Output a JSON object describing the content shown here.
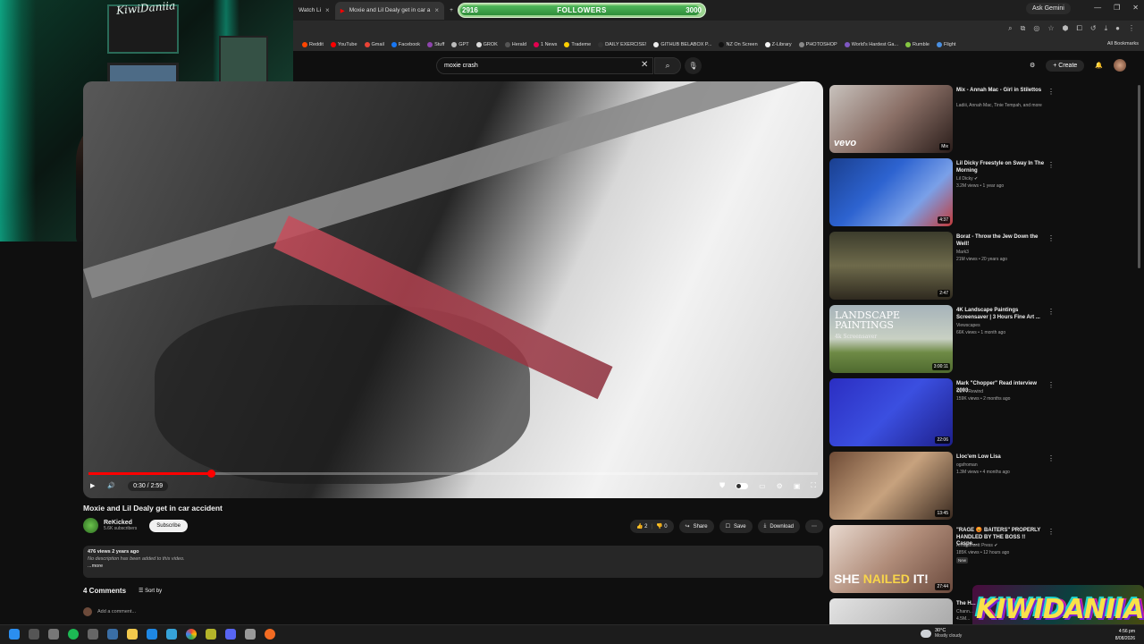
{
  "browser": {
    "tabs": [
      {
        "label": "Watch Li"
      },
      {
        "label": "Moxie and Lil Dealy get in car a"
      }
    ],
    "followers": {
      "current": "2916",
      "label": "FOLLOWERS",
      "goal": "3000",
      "progress_fraction": 0.972
    },
    "ask_gemini": "Ask Gemini",
    "bookmarks": [
      {
        "label": "Reddit",
        "color": "#ff4500"
      },
      {
        "label": "YouTube",
        "color": "#ff0000"
      },
      {
        "label": "Gmail",
        "color": "#ea4335"
      },
      {
        "label": "Facebook",
        "color": "#1877f2"
      },
      {
        "label": "Stuff",
        "color": "#8e44ad"
      },
      {
        "label": "GPT",
        "color": "#bbbbbb"
      },
      {
        "label": "GROK",
        "color": "#dddddd"
      },
      {
        "label": "Herald",
        "color": "#555555"
      },
      {
        "label": "1 News",
        "color": "#e3004f"
      },
      {
        "label": "Trademe",
        "color": "#ffcf00"
      },
      {
        "label": "DAILY EXERCISE!",
        "color": "#333333"
      },
      {
        "label": "GITHUB BELABOX P...",
        "color": "#eeeeee"
      },
      {
        "label": "NZ On Screen",
        "color": "#111111"
      },
      {
        "label": "Z-Library",
        "color": "#f5f5f5"
      },
      {
        "label": "PHOTOSHOP",
        "color": "#888888"
      },
      {
        "label": "World's Hardest Ga...",
        "color": "#7e57c2"
      },
      {
        "label": "Rumble",
        "color": "#85c742"
      },
      {
        "label": "Flight",
        "color": "#4a90e2"
      }
    ],
    "all_bookmarks": "All Bookmarks"
  },
  "youtube": {
    "search_value": "moxie crash",
    "create_label": "Create",
    "player": {
      "time": "0:30 / 2:59",
      "progress_fraction": 0.1676
    },
    "video_title": "Moxie and Lil Dealy get in car accident",
    "channel": {
      "name": "ReKicked",
      "subs": "5.6K subscribers",
      "subscribe": "Subscribe"
    },
    "actions": {
      "likes": "2",
      "dislikes": "0",
      "share": "Share",
      "save": "Save",
      "download": "Download"
    },
    "description": {
      "meta": "476 views  2 years ago",
      "text": "No description has been added to this video.",
      "more": "...more"
    },
    "comments": {
      "count": "4 Comments",
      "sort": "Sort by",
      "add": "Add a comment..."
    },
    "recommendations": [
      {
        "title": "Mix - Annah Mac - Girl in Stilettos",
        "channel": "Ladiii, Annah Mac, Tinie Tempah, and more",
        "meta": "",
        "duration": "Mix",
        "thumb": "vevo"
      },
      {
        "title": "Lil Dicky Freestyle on Sway In The Morning",
        "channel": "Lil Dicky ✔",
        "meta": "3.2M views • 1 year ago",
        "duration": "4:37",
        "thumb": "sway"
      },
      {
        "title": "Borat - Throw the Jew Down the Well!",
        "channel": "Mark3",
        "meta": "21M views • 20 years ago",
        "duration": "2:47",
        "thumb": "borat"
      },
      {
        "title": "4K Landscape Paintings Screensaver | 3 Hours Fine Art ...",
        "channel": "Viewscapes",
        "meta": "66K views • 1 month ago",
        "duration": "3:00:11",
        "thumb": "landscape"
      },
      {
        "title": "Mark \"Chopper\" Read interview 2003",
        "channel": "OZTVRewind",
        "meta": "159K views • 2 months ago",
        "duration": "22:06",
        "thumb": "chopper"
      },
      {
        "title": "Lloc'em Low Lisa",
        "channel": "ogsfroman",
        "meta": "1.3M views • 4 months ago",
        "duration": "13:45",
        "thumb": "lisa"
      },
      {
        "title": "\"RAGE 😡 BAITERS\" PROPERLY HANDLED BY THE BOSS !! Caspe...",
        "channel": "Amagansett Press ✔",
        "meta": "185K views • 12 hours ago",
        "duration": "27:44",
        "thumb": "nailed",
        "badge": "New"
      },
      {
        "title": "The H...",
        "channel": "Chann...",
        "meta": "4.5M...",
        "duration": "",
        "thumb": "last"
      }
    ],
    "landscape_thumb": {
      "title1": "LANDSCAPE",
      "title2": "PAINTINGS",
      "sub": "4k Screensaver"
    },
    "nailed_thumb": {
      "a": "SHE ",
      "b": "NAILED",
      "c": " IT!"
    },
    "vevo_text": "vevo"
  },
  "overlay": {
    "webcam_logo": "KiwiDaniia",
    "brand": "KIWIDANIIA"
  },
  "taskbar": {
    "temp": "30°C",
    "condition": "Mostly cloudy",
    "time": "4:56 pm",
    "date": "8/08/2026",
    "lang": "ENG"
  }
}
